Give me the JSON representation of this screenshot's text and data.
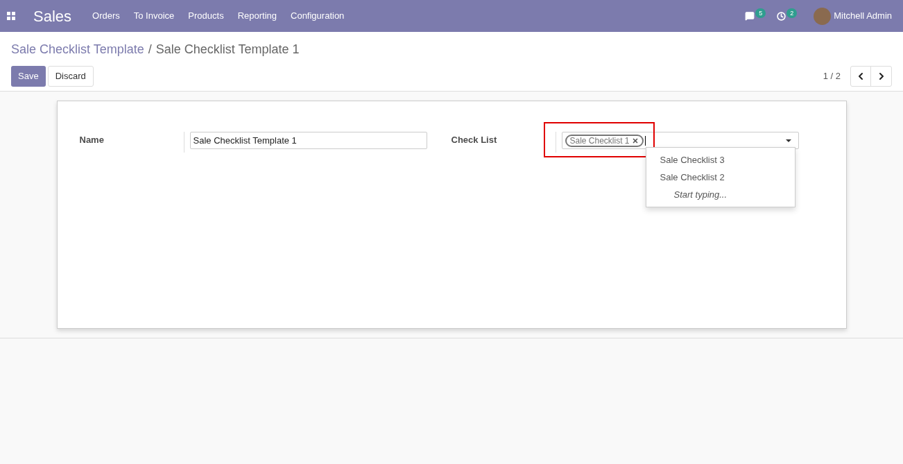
{
  "navbar": {
    "app": "Sales",
    "menu": [
      "Orders",
      "To Invoice",
      "Products",
      "Reporting",
      "Configuration"
    ],
    "messages_count": "5",
    "activities_count": "2",
    "user": "Mitchell Admin"
  },
  "breadcrumb": {
    "parent": "Sale Checklist Template",
    "separator": "/",
    "current": "Sale Checklist Template 1"
  },
  "buttons": [
    "Save",
    "Discard"
  ],
  "pager": "1 / 2",
  "form": {
    "name_label": "Name",
    "name_value": "Sale Checklist Template 1",
    "checklist_label": "Check List",
    "tags": [
      "Sale Checklist 1"
    ],
    "dropdown": [
      {
        "label": "Sale Checklist 3",
        "kind": "option"
      },
      {
        "label": "Sale Checklist 2",
        "kind": "option"
      },
      {
        "label": "Start typing...",
        "kind": "hint"
      }
    ]
  }
}
